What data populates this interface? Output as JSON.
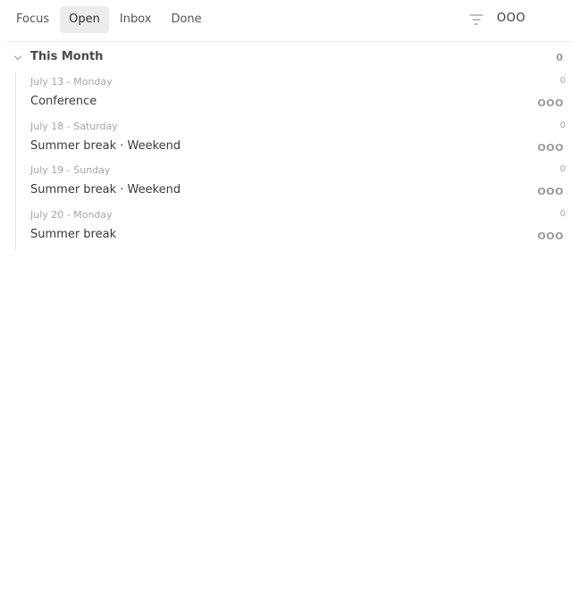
{
  "tabs": [
    {
      "label": "Focus",
      "active": false
    },
    {
      "label": "Open",
      "active": true
    },
    {
      "label": "Inbox",
      "active": false
    },
    {
      "label": "Done",
      "active": false
    }
  ],
  "toolbar": {
    "filter_icon": "filter-icon",
    "ooo_label": "OOO"
  },
  "group": {
    "title": "This Month",
    "count": "0",
    "expanded": true,
    "icon": "chevron-down-icon"
  },
  "items": [
    {
      "date": "July 13 - Monday",
      "count": "0",
      "title": "Conference",
      "ooo": "OOO"
    },
    {
      "date": "July 18 - Saturday",
      "count": "0",
      "title": "Summer break · Weekend",
      "ooo": "OOO"
    },
    {
      "date": "July 19 - Sunday",
      "count": "0",
      "title": "Summer break · Weekend",
      "ooo": "OOO"
    },
    {
      "date": "July 20 - Monday",
      "count": "0",
      "title": "Summer break",
      "ooo": "OOO"
    }
  ],
  "colors": {
    "active_tab_bg": "#ececec",
    "muted_text": "#a5a5a5",
    "body_text": "#3a3a3a"
  }
}
